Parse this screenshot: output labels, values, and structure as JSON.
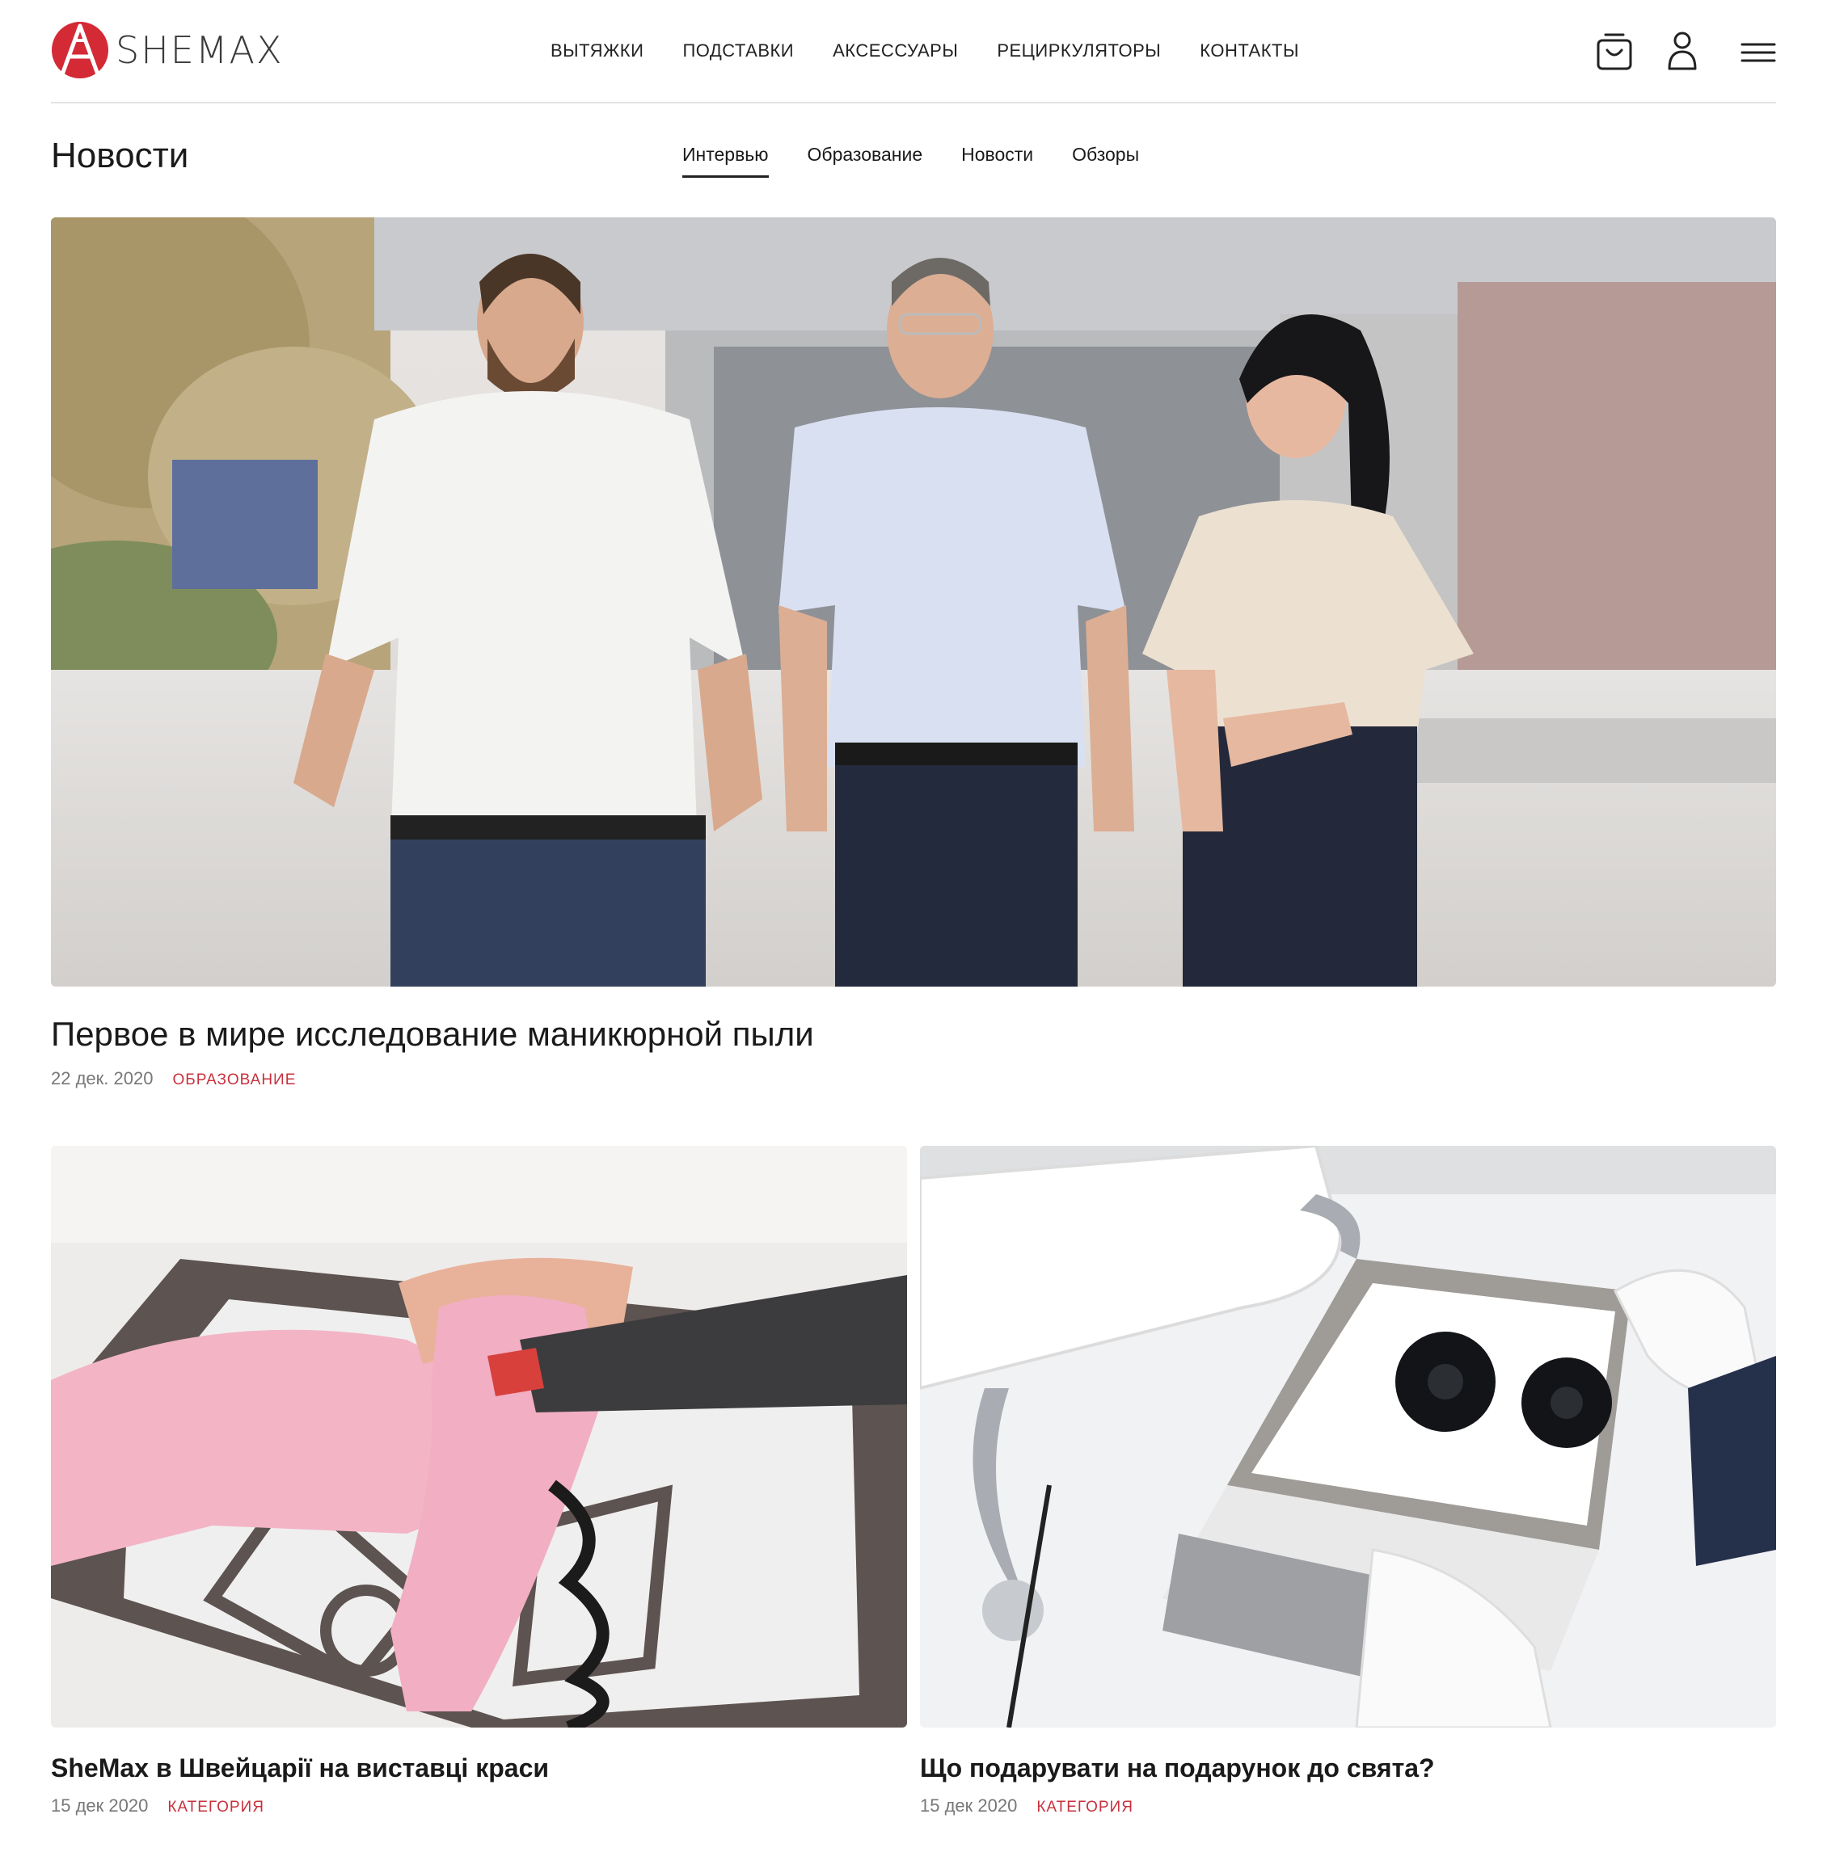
{
  "brand": {
    "name": "SHEMAX",
    "accent": "#d42a36"
  },
  "nav": {
    "items": [
      {
        "label": "ВЫТЯЖКИ"
      },
      {
        "label": "ПОДСТАВКИ"
      },
      {
        "label": "АКСЕССУАРЫ"
      },
      {
        "label": "РЕЦИРКУЛЯТОРЫ"
      },
      {
        "label": "КОНТАКТЫ"
      }
    ],
    "icons": [
      "cart-icon",
      "user-icon",
      "menu-icon"
    ]
  },
  "page": {
    "title": "Новости",
    "tabs": [
      {
        "label": "Интервью",
        "active": true
      },
      {
        "label": "Образование",
        "active": false
      },
      {
        "label": "Новости",
        "active": false
      },
      {
        "label": "Обзоры",
        "active": false
      }
    ]
  },
  "featured": {
    "title": "Первое в мире исследование маникюрной пыли",
    "date": "22 дек. 2020",
    "category": "ОБРАЗОВАНИЕ"
  },
  "articles": [
    {
      "title": "SheMax в Швейцарії на виставці краси",
      "date": "15 дек 2020",
      "category": "КАТЕГОРИЯ"
    },
    {
      "title": "Що подарувати на подарунок до свята?",
      "date": "15 дек 2020",
      "category": "КАТЕГОРИЯ"
    }
  ],
  "colors": {
    "category": "#c8313d",
    "meta": "#777777",
    "divider": "#e3e3e3"
  }
}
